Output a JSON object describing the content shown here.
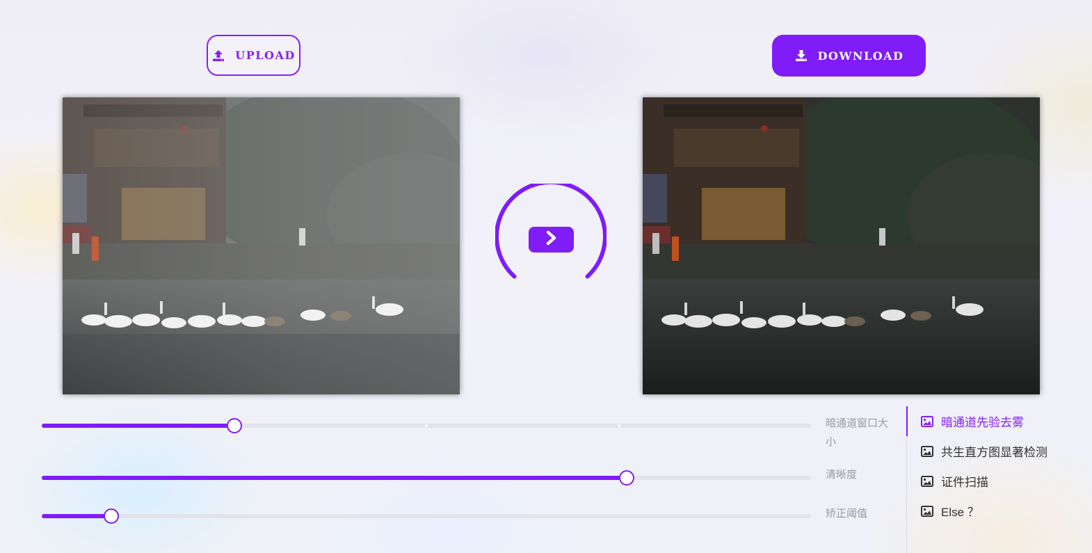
{
  "toolbar": {
    "upload_label": "UPLOAD",
    "download_label": "DOWNLOAD"
  },
  "images": {
    "original": "original-foggy-photo",
    "result": "dehazed-result-photo"
  },
  "sliders": [
    {
      "label": "暗通道窗口大小",
      "value_fraction": 0.25,
      "marks": [
        0.5,
        0.75
      ]
    },
    {
      "label": "清晰度",
      "value_fraction": 0.76
    },
    {
      "label": "矫正阈值",
      "value_fraction": 0.09
    }
  ],
  "nav": {
    "items": [
      {
        "label": "暗通道先验去雾",
        "icon": "image-icon",
        "active": true
      },
      {
        "label": "共生直方图显著检测",
        "icon": "image-icon",
        "active": false
      },
      {
        "label": "证件扫描",
        "icon": "image-icon",
        "active": false
      },
      {
        "label": "Else ？",
        "icon": "image-icon",
        "active": false
      }
    ]
  },
  "colors": {
    "accent": "#7f1cf8",
    "accent_text": "#8620f7",
    "track": "#e3e3ea",
    "label": "#9a9aa0"
  }
}
